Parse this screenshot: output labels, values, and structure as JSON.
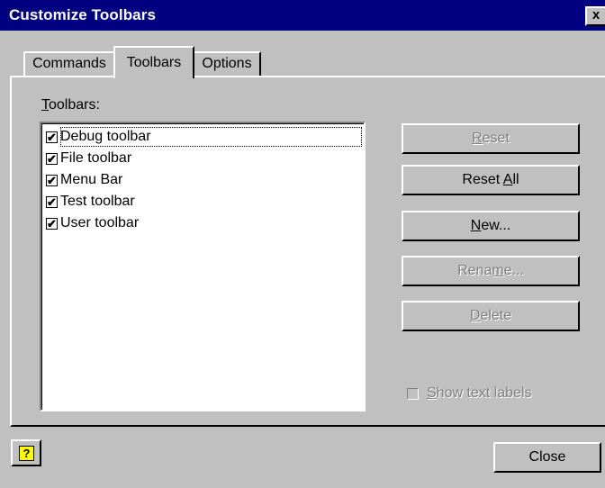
{
  "window": {
    "title": "Customize Toolbars",
    "close_glyph": "x"
  },
  "tabs": [
    {
      "label": "Commands",
      "active": false
    },
    {
      "label": "Toolbars",
      "active": true
    },
    {
      "label": "Options",
      "active": false
    }
  ],
  "toolbars_panel": {
    "list_label_mnemonic": "T",
    "list_label_rest": "oolbars:",
    "items": [
      {
        "label": "Debug toolbar",
        "checked": true,
        "focused": true
      },
      {
        "label": "File toolbar",
        "checked": true
      },
      {
        "label": "Menu Bar",
        "checked": true
      },
      {
        "label": "Test toolbar",
        "checked": true
      },
      {
        "label": "User toolbar",
        "checked": true
      }
    ],
    "buttons": {
      "reset": {
        "mnemonic": "R",
        "rest": "eset",
        "enabled": false
      },
      "reset_all": {
        "before": "Reset ",
        "mnemonic": "A",
        "rest": "ll",
        "enabled": true
      },
      "new": {
        "mnemonic": "N",
        "rest": "ew...",
        "enabled": true
      },
      "rename": {
        "before": "Rena",
        "mnemonic": "m",
        "rest": "e...",
        "enabled": false
      },
      "delete": {
        "mnemonic": "D",
        "rest": "elete",
        "enabled": false
      }
    },
    "show_text_labels": {
      "mnemonic": "S",
      "rest": "how text labels",
      "checked": false,
      "enabled": false
    }
  },
  "footer": {
    "help_glyph": "?",
    "close_label": "Close"
  },
  "icons": {
    "checkmark": "✔",
    "help": "help-icon"
  }
}
